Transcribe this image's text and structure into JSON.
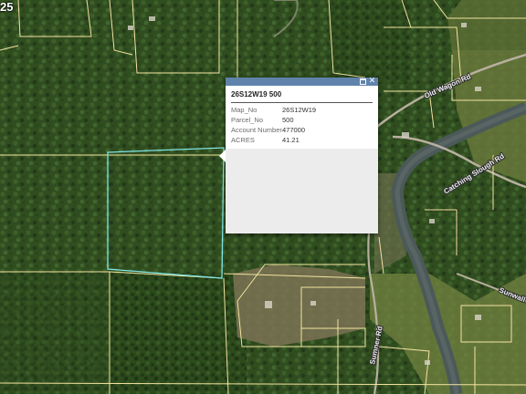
{
  "map": {
    "corner_label": "25",
    "roads": [
      "Old Wagon Rd",
      "Catching Slough Rd",
      "Sunwall Ln",
      "Sumner Rd"
    ],
    "colors": {
      "forest": "#2f4c1e",
      "parcel_line": "#f3e3a0",
      "selected_parcel": "#7fe6e6",
      "river": "#4b5958",
      "road": "#b9b0a0"
    }
  },
  "popup": {
    "title": "26S12W19 500",
    "maximize_icon": "maximize-icon",
    "close_icon": "close-icon",
    "close_glyph": "✕",
    "attributes": [
      {
        "name": "Map_No",
        "value": "26S12W19"
      },
      {
        "name": "Parcel_No",
        "value": "500"
      },
      {
        "name": "Account Number",
        "value": "477000"
      },
      {
        "name": "ACRES",
        "value": "41.21"
      }
    ]
  }
}
